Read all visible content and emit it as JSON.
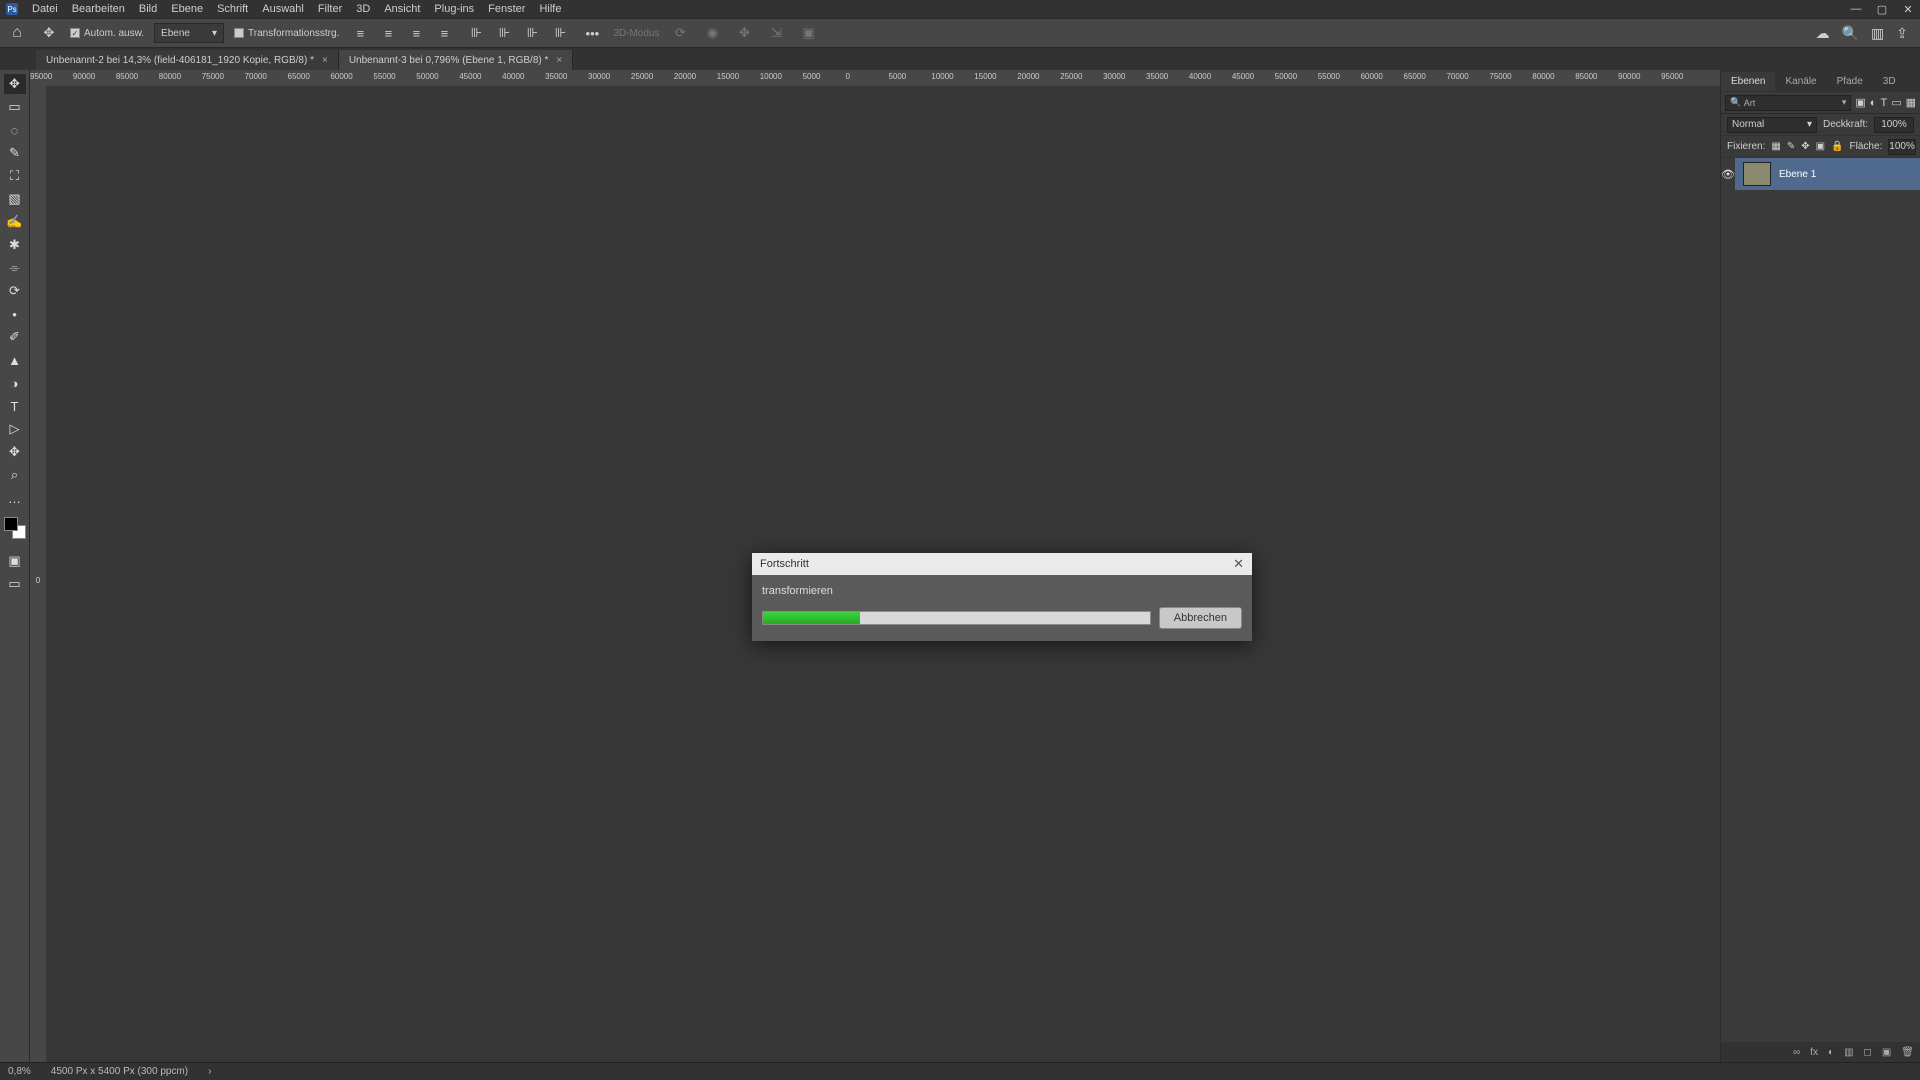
{
  "app": {
    "logo_label": "Ps"
  },
  "menubar": [
    "Datei",
    "Bearbeiten",
    "Bild",
    "Ebene",
    "Schrift",
    "Auswahl",
    "Filter",
    "3D",
    "Ansicht",
    "Plug-ins",
    "Fenster",
    "Hilfe"
  ],
  "window_controls": {
    "min": "—",
    "max": "▢",
    "close": "✕"
  },
  "optionsbar": {
    "auto_select_label": "Autom. ausw.",
    "target_dropdown": "Ebene",
    "transform_controls": "Transformationsstrg.",
    "mode_3d_label": "3D-Modus",
    "more": "•••"
  },
  "documents": [
    {
      "title": "Unbenannt-2 bei 14,3% (field-406181_1920 Kopie, RGB/8) *",
      "active": false
    },
    {
      "title": "Unbenannt-3 bei 0,796% (Ebene 1, RGB/8) *",
      "active": true
    }
  ],
  "ruler_marks": [
    "95000",
    "90000",
    "85000",
    "80000",
    "75000",
    "70000",
    "65000",
    "60000",
    "55000",
    "50000",
    "45000",
    "40000",
    "35000",
    "30000",
    "25000",
    "20000",
    "15000",
    "10000",
    "5000",
    "0",
    "5000",
    "10000",
    "15000",
    "20000",
    "25000",
    "30000",
    "35000",
    "40000",
    "45000",
    "50000",
    "55000",
    "60000",
    "65000",
    "70000",
    "75000",
    "80000",
    "85000",
    "90000",
    "95000"
  ],
  "ruler_zero_vertical": "0",
  "statusbar": {
    "zoom": "0,8%",
    "doc_size": "4500 Px x 5400 Px (300 ppcm)",
    "arrow": "›"
  },
  "panels": {
    "tabs": [
      "Ebenen",
      "Kanäle",
      "Pfade",
      "3D"
    ],
    "active_tab": "Ebenen",
    "search": {
      "placeholder": "Art"
    },
    "blend_mode": "Normal",
    "opacity_label": "Deckkraft:",
    "opacity_value": "100%",
    "lock_label": "Fixieren:",
    "fill_label": "Fläche:",
    "fill_value": "100%",
    "layers": [
      {
        "name": "Ebene 1"
      }
    ],
    "footer_icons": [
      "∞",
      "fx",
      "◐",
      "▥",
      "◻",
      "▣",
      "🗑"
    ]
  },
  "dialog": {
    "title": "Fortschritt",
    "task": "transformieren",
    "percent": 25,
    "cancel": "Abbrechen"
  },
  "tools": [
    "✥",
    "▭",
    "◌",
    "✎",
    "⛶",
    "▧",
    "✍",
    "✱",
    "⌯",
    "⟳",
    "•",
    "✐",
    "▲",
    "◑",
    "T",
    "▷",
    "✥",
    "⌕"
  ]
}
